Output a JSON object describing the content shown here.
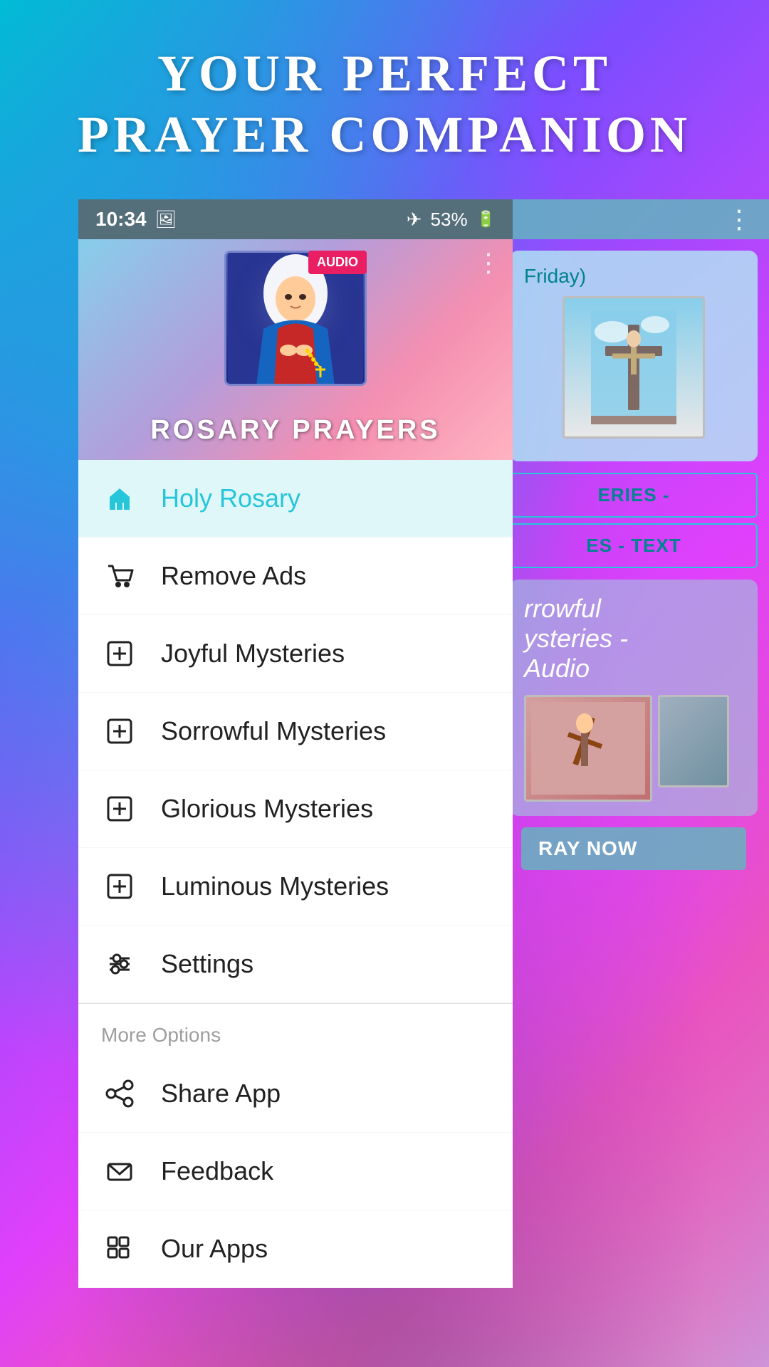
{
  "background": {
    "tagline_line1": "YOUR PERFECT",
    "tagline_line2": "PRAYER COMPANION"
  },
  "status_bar": {
    "time": "10:34",
    "battery": "53%"
  },
  "app_header": {
    "audio_badge": "AUDIO",
    "title": "ROSARY PRAYERS"
  },
  "menu": {
    "items": [
      {
        "id": "holy-rosary",
        "label": "Holy Rosary",
        "icon": "home",
        "active": true
      },
      {
        "id": "remove-ads",
        "label": "Remove Ads",
        "icon": "cart",
        "active": false
      },
      {
        "id": "joyful-mysteries",
        "label": "Joyful Mysteries",
        "icon": "cross-add",
        "active": false
      },
      {
        "id": "sorrowful-mysteries",
        "label": "Sorrowful Mysteries",
        "icon": "cross-add",
        "active": false
      },
      {
        "id": "glorious-mysteries",
        "label": "Glorious Mysteries",
        "icon": "cross-add",
        "active": false
      },
      {
        "id": "luminous-mysteries",
        "label": "Luminous Mysteries",
        "icon": "cross-add",
        "active": false
      },
      {
        "id": "settings",
        "label": "Settings",
        "icon": "settings",
        "active": false
      }
    ],
    "more_options_label": "More Options",
    "more_options": [
      {
        "id": "share-app",
        "label": "Share App",
        "icon": "share"
      },
      {
        "id": "feedback",
        "label": "Feedback",
        "icon": "mail"
      },
      {
        "id": "our-apps",
        "label": "Our Apps",
        "icon": "grid"
      }
    ]
  },
  "bg_content": {
    "card_title": "Friday)",
    "mysteries_btn": "ERIES -",
    "mysteries_text_btn": "ES - TEXT",
    "sorrowful_title": "rrowful\nysteries -\nAudio",
    "pray_btn": "RAY NOW"
  }
}
